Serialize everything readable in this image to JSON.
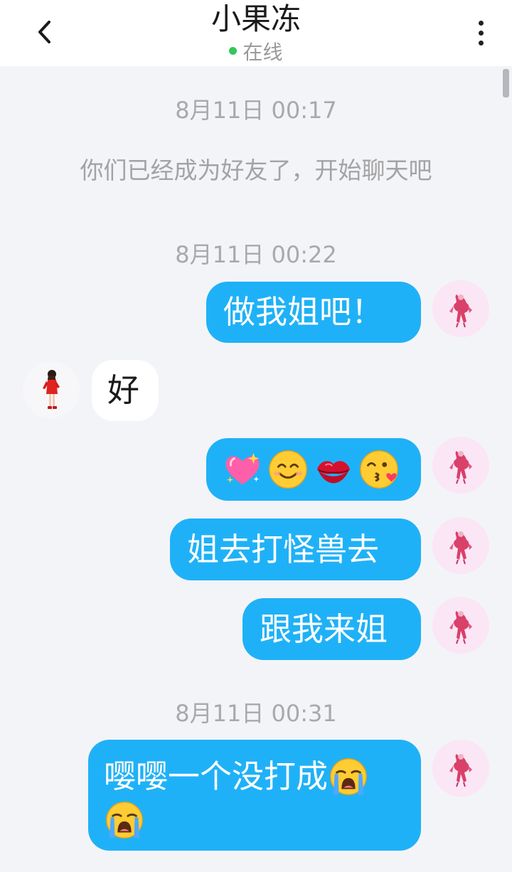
{
  "header": {
    "title": "小果冻",
    "status": "在线",
    "status_color": "#35c759"
  },
  "icons": {
    "back": "chevron-left-icon",
    "more": "more-vertical-icon"
  },
  "colors": {
    "outgoing_bubble": "#1fb1f7",
    "incoming_bubble": "#ffffff",
    "background": "#f3f4f7"
  },
  "chat": {
    "timestamp_1": "8月11日 00:17",
    "system_message": "你们已经成为好友了，开始聊天吧",
    "timestamp_2": "8月11日 00:22",
    "timestamp_3": "8月11日 00:31",
    "messages": [
      {
        "direction": "out",
        "text": "做我姐吧！"
      },
      {
        "direction": "in",
        "text": "好"
      },
      {
        "direction": "out",
        "emojis": [
          "sparkling-heart",
          "smiling-face",
          "kiss-mark",
          "face-blowing-kiss"
        ]
      },
      {
        "direction": "out",
        "text": "姐去打怪兽去"
      },
      {
        "direction": "out",
        "text": "跟我来姐"
      },
      {
        "direction": "out",
        "text": "嘤嘤一个没打成",
        "emojis": [
          "loudly-crying-face",
          "loudly-crying-face"
        ]
      }
    ]
  }
}
